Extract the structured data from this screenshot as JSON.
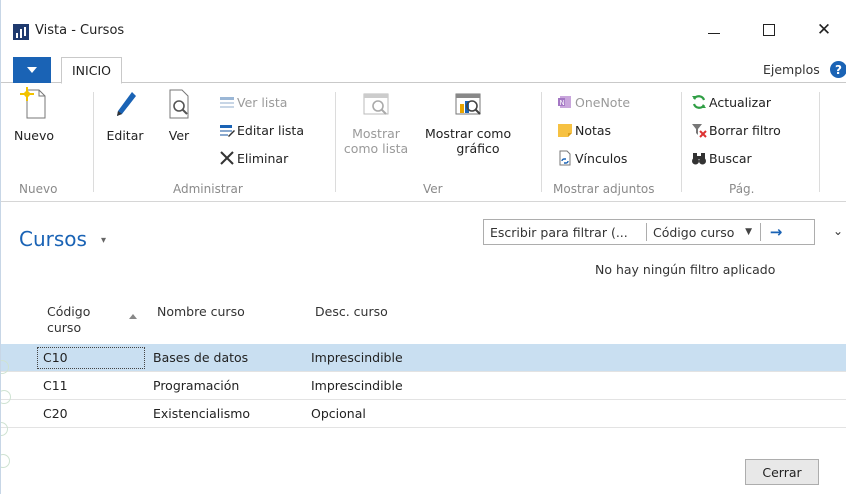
{
  "window": {
    "title": "Vista - Cursos",
    "minimize_symbol": "",
    "maximize_symbol": "",
    "close_symbol": "✕"
  },
  "ribbon_tabs": {
    "file_tab_icon": "caret-down-icon",
    "active_tab": "INICIO",
    "right_link": "Ejemplos",
    "help_symbol": "?"
  },
  "ribbon": {
    "groups": {
      "nuevo": "Nuevo",
      "administrar": "Administrar",
      "ver": "Ver",
      "mostrar_adjuntos": "Mostrar adjuntos",
      "pag": "Pág."
    },
    "buttons": {
      "nuevo": "Nuevo",
      "editar": "Editar",
      "ver": "Ver",
      "ver_lista": "Ver lista",
      "editar_lista": "Editar lista",
      "eliminar": "Eliminar",
      "mostrar_como_lista_1": "Mostrar",
      "mostrar_como_lista_2": "como lista",
      "mostrar_como_grafico_1": "Mostrar como",
      "mostrar_como_grafico_2": "gráfico",
      "onenote": "OneNote",
      "notas": "Notas",
      "vinculos": "Vínculos",
      "actualizar": "Actualizar",
      "borrar_filtro": "Borrar filtro",
      "buscar": "Buscar"
    }
  },
  "page": {
    "title": "Cursos",
    "title_caret": "▾",
    "filter_placeholder": "Escribir para filtrar (...",
    "filter_field": "Código curso",
    "filter_field_caret": "▼",
    "filter_go": "→",
    "collapse_caret": "⌄",
    "filter_status": "No hay ningún filtro aplicado"
  },
  "grid": {
    "columns": {
      "codigo_1": "Código",
      "codigo_2": "curso",
      "nombre": "Nombre curso",
      "desc": "Desc. curso"
    },
    "rows": [
      {
        "codigo": "C10",
        "nombre": "Bases de datos",
        "desc": "Imprescindible"
      },
      {
        "codigo": "C11",
        "nombre": "Programación",
        "desc": "Imprescindible"
      },
      {
        "codigo": "C20",
        "nombre": "Existencialismo",
        "desc": "Opcional"
      }
    ],
    "selected_row": 0
  },
  "footer": {
    "close_label": "Cerrar"
  },
  "colors": {
    "accent": "#1a63b5",
    "selection": "#c9dff1",
    "disabled_text": "#9a9a9a"
  }
}
